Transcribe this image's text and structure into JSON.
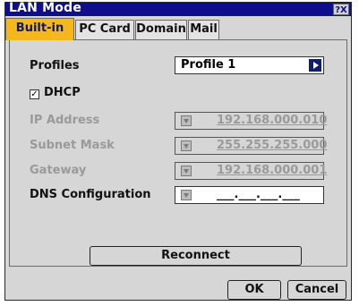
{
  "window": {
    "title": "LAN Mode",
    "help_label": "?X"
  },
  "tabs": [
    {
      "label": "Built-in",
      "active": true
    },
    {
      "label": "PC Card"
    },
    {
      "label": "Domain"
    },
    {
      "label": "Mail"
    }
  ],
  "profiles": {
    "label": "Profiles",
    "value": "Profile 1"
  },
  "dhcp": {
    "label": "DHCP",
    "checked": true,
    "check_glyph": "✓"
  },
  "fields": {
    "ip": {
      "label": "IP Address",
      "value": "192.168.000.010"
    },
    "subnet": {
      "label": "Subnet Mask",
      "value": "255.255.255.000"
    },
    "gateway": {
      "label": "Gateway",
      "value": "192.168.000.001"
    },
    "dns": {
      "label": "DNS Configuration",
      "value": "___.___.___.___"
    }
  },
  "buttons": {
    "reconnect": "Reconnect",
    "ok": "OK",
    "cancel": "Cancel"
  },
  "colors": {
    "titlebar": "#0f0f8c",
    "active_tab": "#f5b81c",
    "panel_bg": "#d6d6d6"
  }
}
